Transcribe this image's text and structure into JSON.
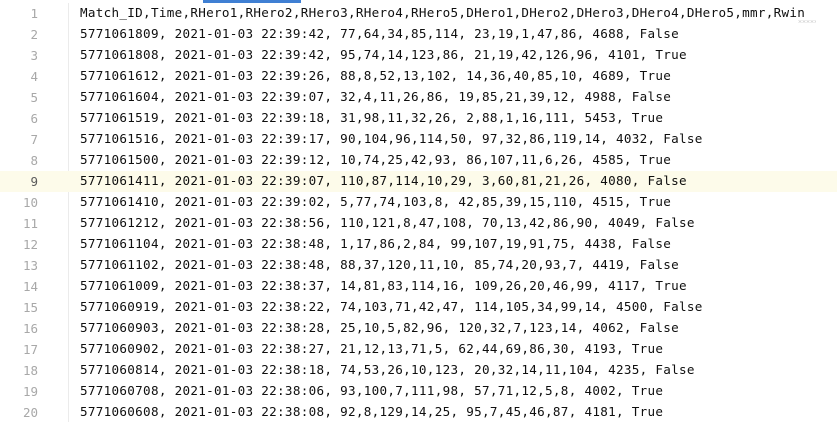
{
  "editor": {
    "current_line": 9,
    "lines": [
      {
        "num": "1",
        "text": "Match_ID,Time,RHero1,RHero2,RHero3,RHero4,RHero5,DHero1,DHero2,DHero3,DHero4,DHero5,mmr,Rwin"
      },
      {
        "num": "2",
        "text": "5771061809, 2021-01-03 22:39:42, 77,64,34,85,114, 23,19,1,47,86, 4688, False"
      },
      {
        "num": "3",
        "text": "5771061808, 2021-01-03 22:39:42, 95,74,14,123,86, 21,19,42,126,96, 4101, True"
      },
      {
        "num": "4",
        "text": "5771061612, 2021-01-03 22:39:26, 88,8,52,13,102, 14,36,40,85,10, 4689, True"
      },
      {
        "num": "5",
        "text": "5771061604, 2021-01-03 22:39:07, 32,4,11,26,86, 19,85,21,39,12, 4988, False"
      },
      {
        "num": "6",
        "text": "5771061519, 2021-01-03 22:39:18, 31,98,11,32,26, 2,88,1,16,111, 5453, True"
      },
      {
        "num": "7",
        "text": "5771061516, 2021-01-03 22:39:17, 90,104,96,114,50, 97,32,86,119,14, 4032, False"
      },
      {
        "num": "8",
        "text": "5771061500, 2021-01-03 22:39:12, 10,74,25,42,93, 86,107,11,6,26, 4585, True"
      },
      {
        "num": "9",
        "text": "5771061411, 2021-01-03 22:39:07, 110,87,114,10,29, 3,60,81,21,26, 4080, False"
      },
      {
        "num": "10",
        "text": "5771061410, 2021-01-03 22:39:02, 5,77,74,103,8, 42,85,39,15,110, 4515, True"
      },
      {
        "num": "11",
        "text": "5771061212, 2021-01-03 22:38:56, 110,121,8,47,108, 70,13,42,86,90, 4049, False"
      },
      {
        "num": "12",
        "text": "5771061104, 2021-01-03 22:38:48, 1,17,86,2,84, 99,107,19,91,75, 4438, False"
      },
      {
        "num": "13",
        "text": "5771061102, 2021-01-03 22:38:48, 88,37,120,11,10, 85,74,20,93,7, 4419, False"
      },
      {
        "num": "14",
        "text": "5771061009, 2021-01-03 22:38:37, 14,81,83,114,16, 109,26,20,46,99, 4117, True"
      },
      {
        "num": "15",
        "text": "5771060919, 2021-01-03 22:38:22, 74,103,71,42,47, 114,105,34,99,14, 4500, False"
      },
      {
        "num": "16",
        "text": "5771060903, 2021-01-03 22:38:28, 25,10,5,82,96, 120,32,7,123,14, 4062, False"
      },
      {
        "num": "17",
        "text": "5771060902, 2021-01-03 22:38:27, 21,12,13,71,5, 62,44,69,86,30, 4193, True"
      },
      {
        "num": "18",
        "text": "5771060814, 2021-01-03 22:38:18, 74,53,26,10,123, 20,32,14,11,104, 4235, False"
      },
      {
        "num": "19",
        "text": "5771060708, 2021-01-03 22:38:06, 93,100,7,111,98, 57,71,12,5,8, 4002, True"
      },
      {
        "num": "20",
        "text": "5771060608, 2021-01-03 22:38:08, 92,8,129,14,25, 95,7,45,46,87, 4181, True"
      }
    ]
  }
}
